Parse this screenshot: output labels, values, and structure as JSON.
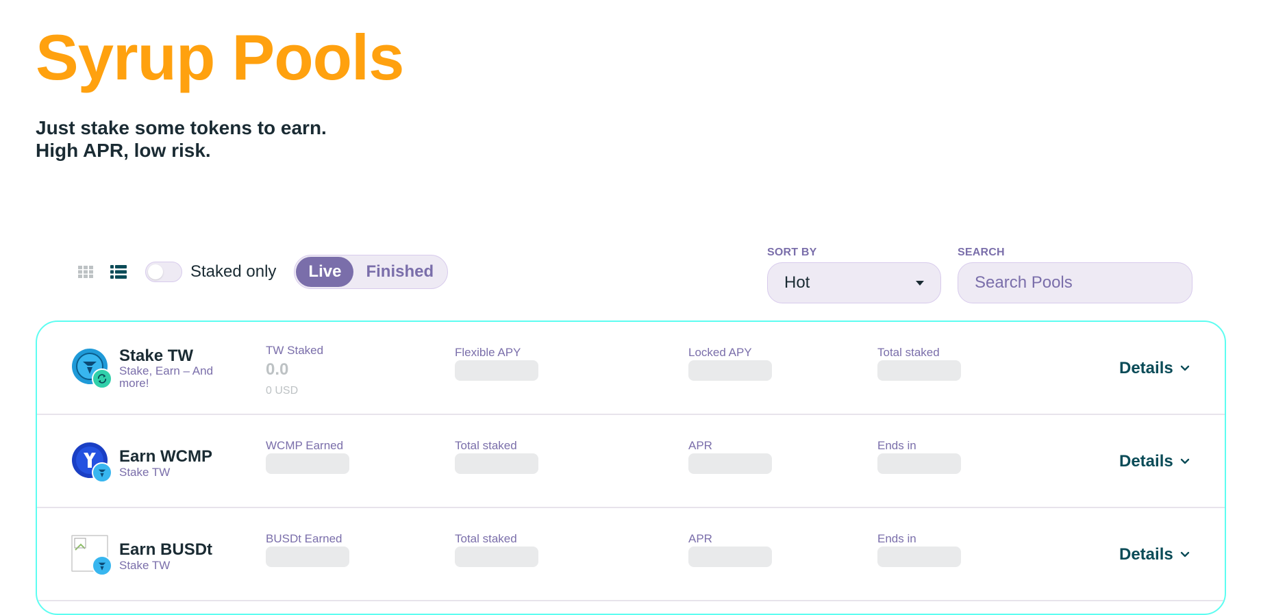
{
  "header": {
    "title": "Syrup Pools",
    "subtitle_line1": "Just stake some tokens to earn.",
    "subtitle_line2": "High APR, low risk."
  },
  "controls": {
    "staked_only_label": "Staked only",
    "tabs": [
      {
        "label": "Live",
        "active": true
      },
      {
        "label": "Finished",
        "active": false
      }
    ],
    "sort_label": "SORT BY",
    "sort_value": "Hot",
    "search_label": "SEARCH",
    "search_placeholder": "Search Pools"
  },
  "pools": [
    {
      "title": "Stake TW",
      "subtitle": "Stake, Earn – And more!",
      "col1_label": "TW Staked",
      "col1_value": "0.0",
      "col1_usd": "0 USD",
      "col2_label": "Flexible APY",
      "col3_label": "Locked APY",
      "col4_label": "Total staked",
      "details_label": "Details"
    },
    {
      "title": "Earn WCMP",
      "subtitle": "Stake TW",
      "col1_label": "WCMP Earned",
      "col2_label": "Total staked",
      "col3_label": "APR",
      "col4_label": "Ends in",
      "details_label": "Details"
    },
    {
      "title": "Earn BUSDt",
      "subtitle": "Stake TW",
      "col1_label": "BUSDt Earned",
      "col2_label": "Total staked",
      "col3_label": "APR",
      "col4_label": "Ends in",
      "details_label": "Details"
    }
  ],
  "colors": {
    "title": "#ffa10f",
    "accent": "#7a6eaa",
    "card_border": "#5dfdf1",
    "dark_text": "#1a2b33",
    "details_text": "#0a4b57"
  }
}
